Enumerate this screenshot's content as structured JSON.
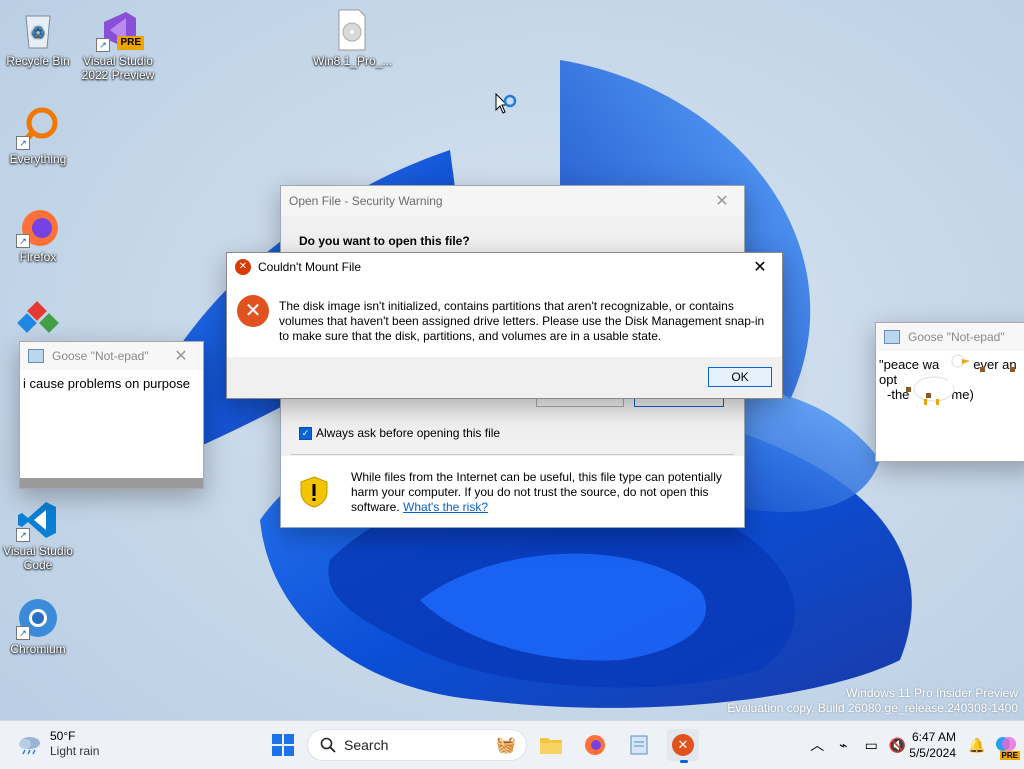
{
  "desktop": {
    "icons": [
      {
        "label": "Recycle Bin"
      },
      {
        "label": "Visual Studio 2022 Preview",
        "badge": "PRE"
      },
      {
        "label": "Win8.1_Pro_..."
      },
      {
        "label": "Everything"
      },
      {
        "label": "Firefox"
      },
      {
        "label": "Visual Studio Code"
      },
      {
        "label": "Chromium"
      }
    ],
    "watermark": {
      "line1": "Windows 11 Pro Insider Preview",
      "line2": "Evaluation copy. Build 26080.ge_release.240308-1400"
    }
  },
  "security_dialog": {
    "title": "Open File - Security Warning",
    "question": "Do you want to open this file?",
    "checkbox_label": "Always ask before opening this file",
    "checkbox_checked": true,
    "warning_text": "While files from the Internet can be useful, this file type can potentially harm your computer. If you do not trust the source, do not open this software.",
    "risk_link": "What's the risk?"
  },
  "error_dialog": {
    "title": "Couldn't Mount File",
    "message": "The disk image isn't initialized, contains partitions that aren't recognizable, or contains volumes that haven't been assigned drive letters. Please use the Disk Management snap-in to make sure that the disk, partitions, and volumes are in a usable state.",
    "ok_label": "OK",
    "accent_color": "#d83b01"
  },
  "goose_notes": [
    {
      "title": "Goose \"Not-epad\"",
      "text": "i cause problems on purpose"
    },
    {
      "title": "Goose \"Not-epad\"",
      "line1": "\"peace wa",
      "line1b": "ever an opt",
      "line2": "-the",
      "line2b": "me)"
    }
  ],
  "taskbar": {
    "weather": {
      "temp": "50°F",
      "condition": "Light rain"
    },
    "search_label": "Search",
    "clock": {
      "time": "6:47 AM",
      "date": "5/5/2024"
    },
    "copilot_badge": "PRE"
  }
}
